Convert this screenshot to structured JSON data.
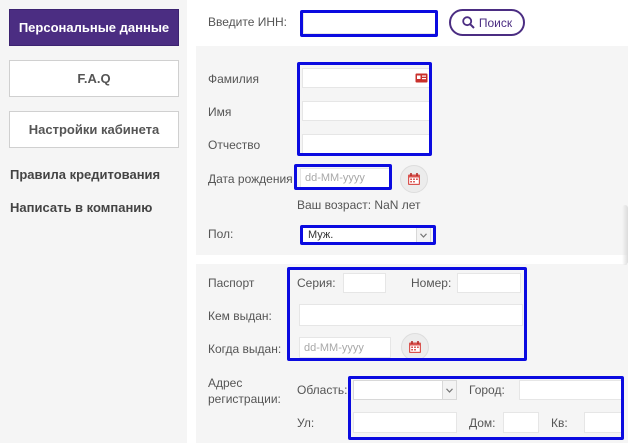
{
  "sidebar": {
    "active_item": "Персональные данные",
    "buttons": [
      "F.A.Q",
      "Настройки кабинета"
    ],
    "links": [
      "Правила кредитования",
      "Написать в компанию"
    ]
  },
  "inn": {
    "label": "Введите ИНН:",
    "value": "",
    "search_label": "Поиск"
  },
  "personal": {
    "surname_label": "Фамилия",
    "name_label": "Имя",
    "patronymic_label": "Отчество",
    "surname_value": "",
    "name_value": "",
    "patronymic_value": ""
  },
  "birth": {
    "label": "Дата рождения",
    "placeholder": "dd-MM-yyyy",
    "age_text": "Ваш возраст: NaN лет"
  },
  "gender": {
    "label": "Пол:",
    "selected": "Муж."
  },
  "passport": {
    "label": "Паспорт",
    "series_label": "Серия:",
    "number_label": "Номер:",
    "issued_by_label": "Кем выдан:",
    "issued_when_label": "Когда выдан:",
    "date_placeholder": "dd-MM-yyyy"
  },
  "address": {
    "label_line1": "Адрес",
    "label_line2": "регистрации:",
    "region_label": "Область:",
    "city_label": "Город:",
    "street_label": "Ул:",
    "house_label": "Дом:",
    "apt_label": "Кв:",
    "region_selected": ""
  },
  "colors": {
    "brand": "#4b2d82",
    "highlight": "#0b0be0",
    "calendar_icon": "#d9534f",
    "id_icon": "#c9302c"
  },
  "icons": {
    "search": "search-icon",
    "calendar": "calendar-icon",
    "id_card": "id-card-icon",
    "chevron": "chevron-down-icon"
  }
}
